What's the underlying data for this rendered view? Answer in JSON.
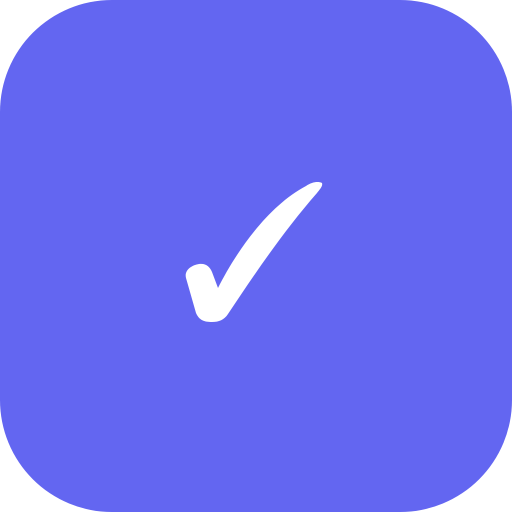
{
  "app_icon": {
    "background_color": "#6366f1",
    "icon": "checkmark-icon",
    "icon_color": "#ffffff"
  }
}
